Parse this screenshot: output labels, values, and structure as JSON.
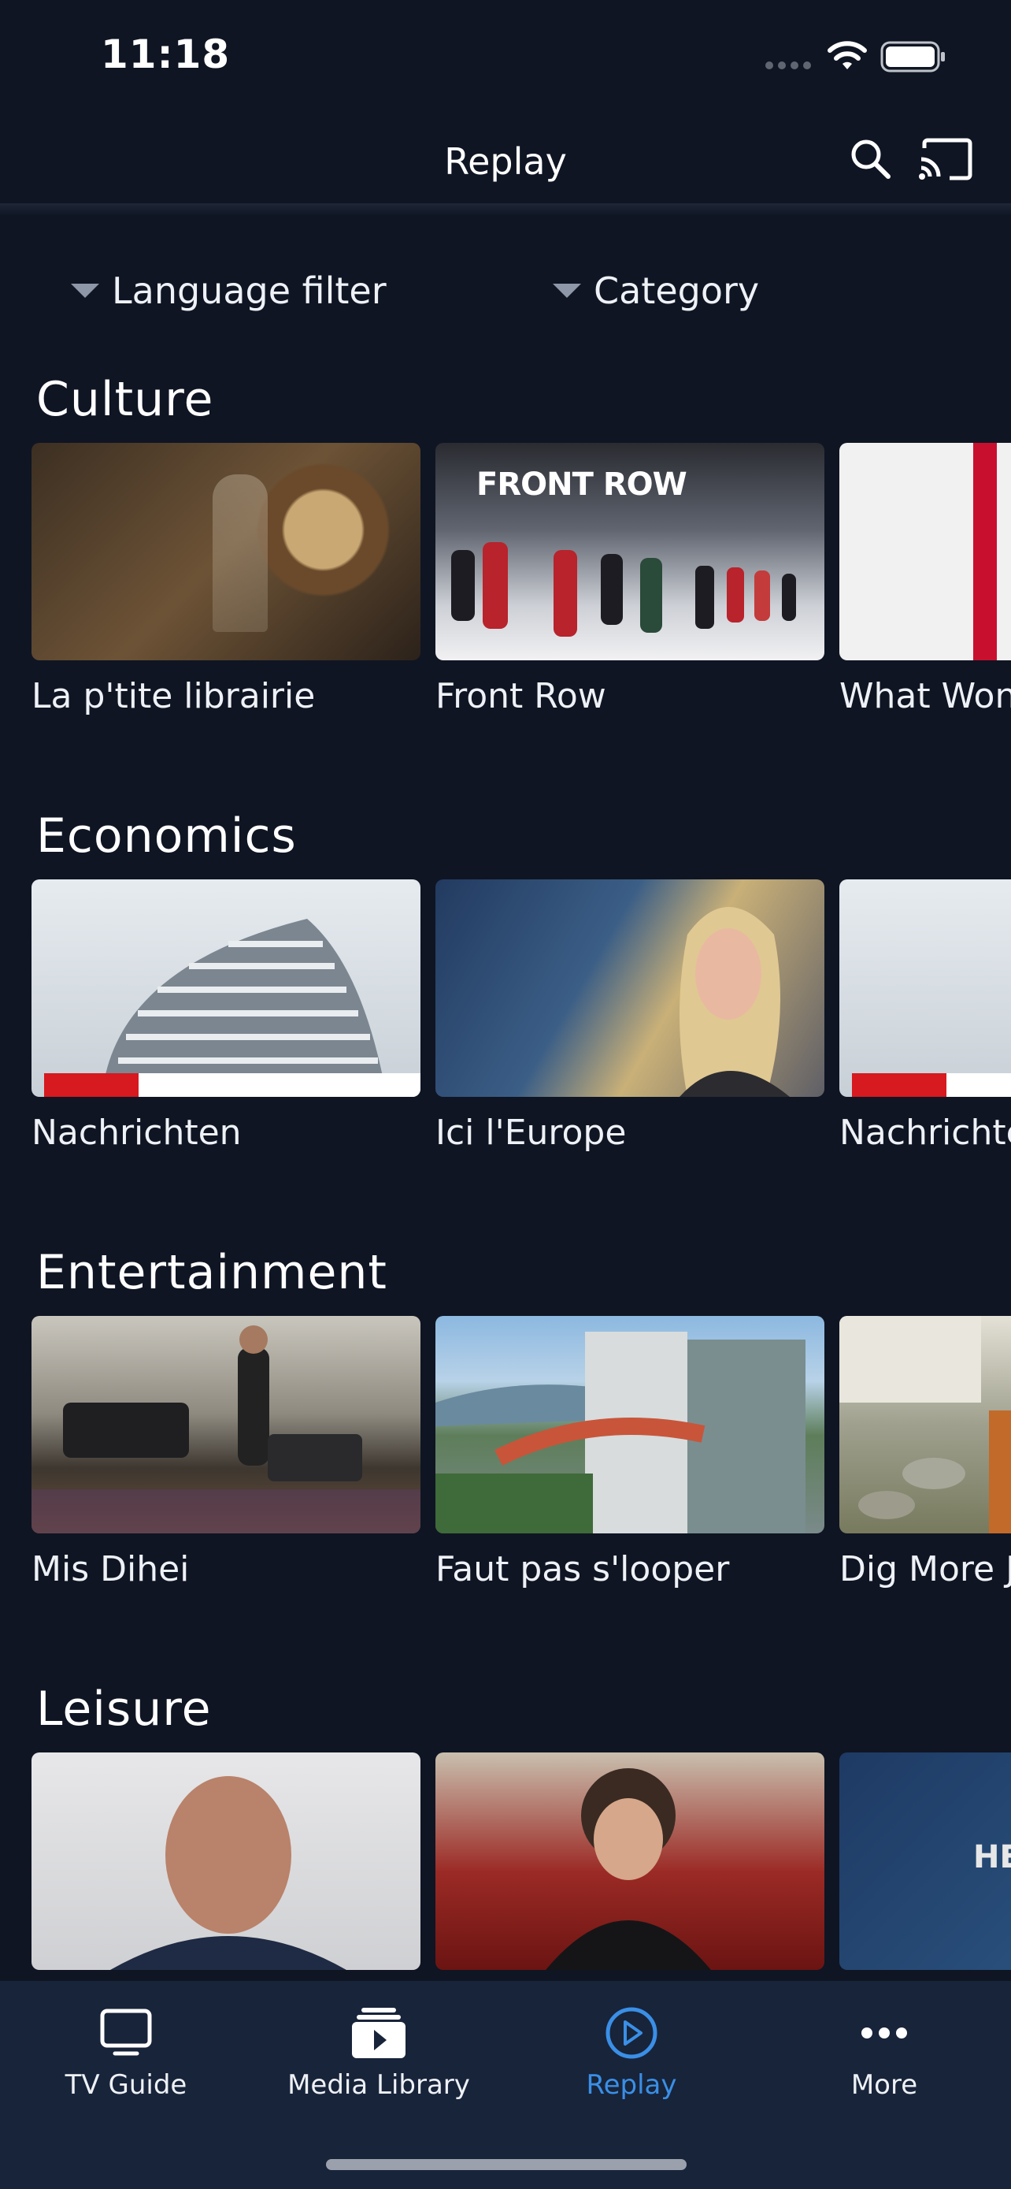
{
  "status": {
    "time": "11:18"
  },
  "header": {
    "title": "Replay"
  },
  "filters": {
    "language": "Language filter",
    "category": "Category"
  },
  "sections": [
    {
      "title": "Culture",
      "items": [
        "La p'tite librairie",
        "Front Row",
        "What Won"
      ]
    },
    {
      "title": "Economics",
      "items": [
        "Nachrichten",
        "Ici l'Europe",
        "Nachrichte"
      ]
    },
    {
      "title": "Entertainment",
      "items": [
        "Mis Dihei",
        "Faut pas s'looper",
        "Dig More J"
      ]
    },
    {
      "title": "Leisure",
      "items": [
        "",
        "",
        ""
      ]
    }
  ],
  "thumb_text": {
    "front_row": "FRONT ROW",
    "leisure_3": "HE"
  },
  "tabs": [
    {
      "label": "TV Guide",
      "icon": "tv-icon"
    },
    {
      "label": "Media Library",
      "icon": "media-library-icon"
    },
    {
      "label": "Replay",
      "icon": "replay-icon",
      "active": true
    },
    {
      "label": "More",
      "icon": "more-icon"
    }
  ],
  "colors": {
    "background": "#0f1523",
    "tabbar": "#18243a",
    "accent": "#3a8fe6"
  }
}
